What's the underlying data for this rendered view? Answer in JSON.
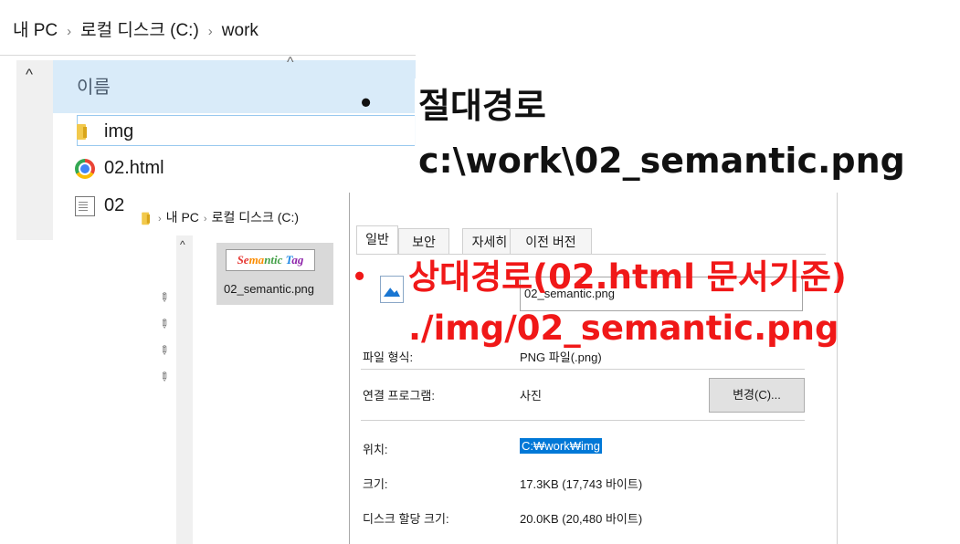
{
  "explorer_top": {
    "breadcrumb": [
      "내 PC",
      "로컬 디스크 (C:)",
      "work"
    ],
    "column_name": "이름",
    "items": [
      {
        "name": "img",
        "icon": "folder-icon"
      },
      {
        "name": "02.html",
        "icon": "chrome-icon"
      },
      {
        "name": "02",
        "icon": "text-file-icon"
      }
    ]
  },
  "explorer_second": {
    "breadcrumb": [
      "내 PC",
      "로컬 디스크 (C:)"
    ],
    "thumbnail_text": "Semantic Tag",
    "file_name": "02_semantic.png"
  },
  "properties": {
    "tabs": [
      "일반",
      "보안",
      "자세히",
      "이전 버전"
    ],
    "active_tab": "일반",
    "file_name_value": "02_semantic.png",
    "file_type_label": "파일 형식:",
    "file_type_value": "PNG 파일(.png)",
    "open_with_label": "연결 프로그램:",
    "open_with_value": "사진",
    "change_button": "변경(C)...",
    "location_label": "위치:",
    "location_value": "C:₩work₩img",
    "size_label": "크기:",
    "size_value": "17.3KB (17,743 바이트)",
    "disk_size_label": "디스크 할당 크기:",
    "disk_size_value": "20.0KB (20,480 바이트)"
  },
  "annotations": {
    "absolute_title": "절대경로",
    "absolute_path": "c:\\work\\02_semantic.png",
    "relative_title": "상대경로(02.html 문서기준)",
    "relative_path": "./img/02_semantic.png",
    "bullet": "•",
    "colors": {
      "absolute": "#111111",
      "relative": "#f01818"
    }
  }
}
